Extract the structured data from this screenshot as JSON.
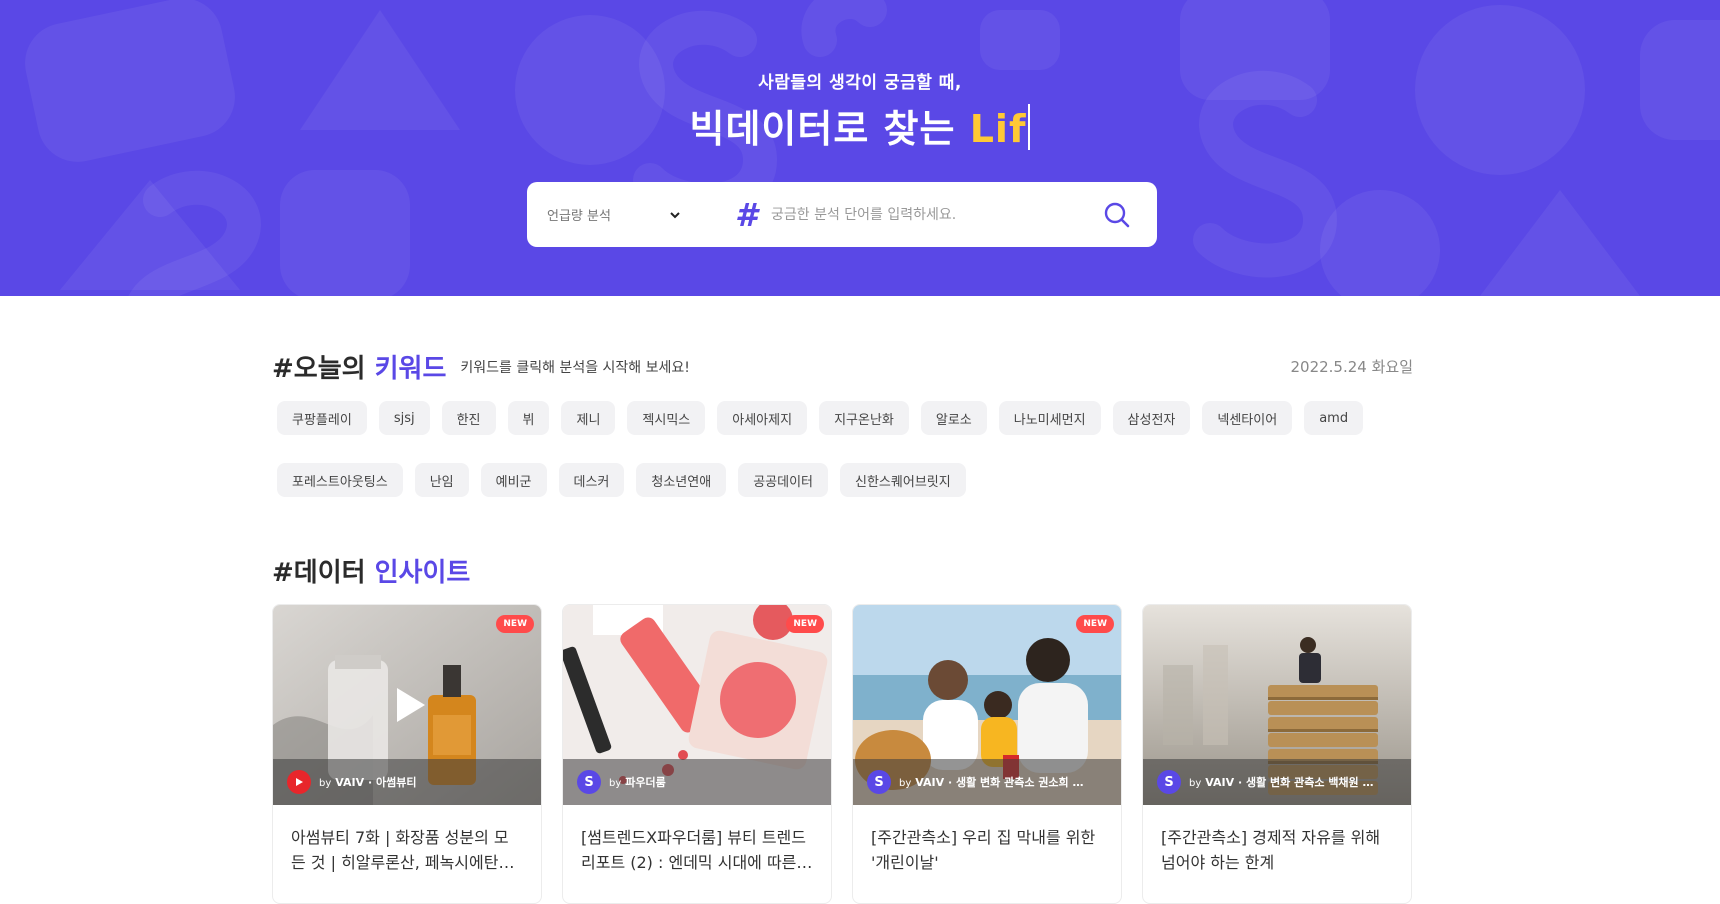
{
  "hero": {
    "subtitle": "사람들의 생각이 궁금할 때,",
    "title_main": "빅데이터로 찾는 ",
    "title_accent": "Lif",
    "accent_color": "#ffc935",
    "bg_color": "#5a48e6"
  },
  "search": {
    "select_value": "언급량 분석",
    "hash_symbol": "#",
    "placeholder": "궁금한 분석 단어를 입력하세요.",
    "icons": {
      "dropdown": "chevron-down-icon",
      "search": "search-icon"
    }
  },
  "keywords": {
    "title_prefix": "#오늘의 ",
    "title_highlight": "키워드",
    "description": "키워드를 클릭해 분석을 시작해 보세요!",
    "date": "2022.5.24 화요일",
    "items": [
      "쿠팡플레이",
      "sjsj",
      "한진",
      "뷔",
      "제니",
      "젝시믹스",
      "아세아제지",
      "지구온난화",
      "알로소",
      "나노미세먼지",
      "삼성전자",
      "넥센타이어",
      "amd",
      "포레스트아웃팅스",
      "난임",
      "예비군",
      "데스커",
      "청소년연애",
      "공공데이터",
      "신한스퀘어브릿지"
    ]
  },
  "insight": {
    "title_prefix": "#데이터 ",
    "title_highlight": "인사이트",
    "cards": [
      {
        "badge": "NEW",
        "source_by": "by",
        "source": "VAIV · 아썸뷰티",
        "source_logo": "youtube-icon",
        "has_video": true,
        "title": "아썸뷰티 7화 | 화장품 성분의 모든 것 | 히알루론산, 페녹시에탄올, …"
      },
      {
        "badge": "NEW",
        "source_by": "by",
        "source": "파우더룸",
        "source_logo": "S",
        "has_video": false,
        "title": "[썸트렌드X파우더룸] 뷰티 트렌드 리포트 (2) : 엔데믹 시대에 따른 …"
      },
      {
        "badge": "NEW",
        "source_by": "by",
        "source": "VAIV · 생활 변화 관측소 권소희 …",
        "source_logo": "S",
        "has_video": false,
        "title": "[주간관측소] 우리 집 막내를 위한 '개린이날'"
      },
      {
        "badge": "",
        "source_by": "by",
        "source": "VAIV · 생활 변화 관측소 백채원 …",
        "source_logo": "S",
        "has_video": false,
        "title": "[주간관측소] 경제적 자유를 위해 넘어야 하는 한계"
      }
    ]
  }
}
